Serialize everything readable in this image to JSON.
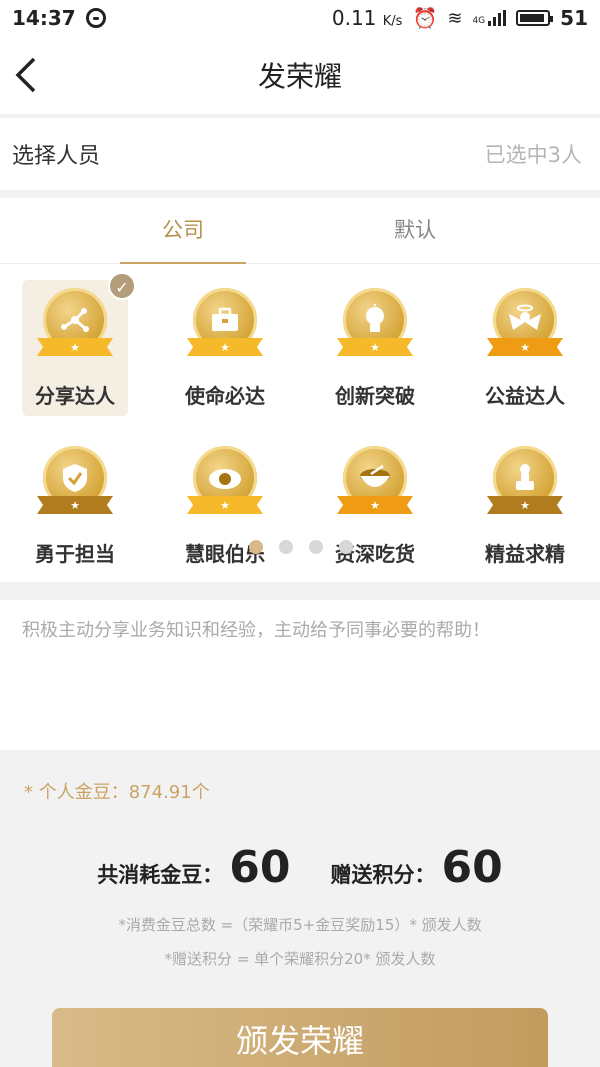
{
  "status_bar": {
    "time": "14:37",
    "speed": "0.11",
    "speed_unit": "K/s",
    "network": "4G",
    "battery": "51"
  },
  "nav": {
    "title": "发荣耀"
  },
  "select_people": {
    "label": "选择人员",
    "value": "已选中3人"
  },
  "tabs": [
    {
      "label": "公司"
    },
    {
      "label": "默认"
    }
  ],
  "badges": [
    {
      "label": "分享达人",
      "icon": "share-nodes"
    },
    {
      "label": "使命必达",
      "icon": "briefcase"
    },
    {
      "label": "创新突破",
      "icon": "lightbulb"
    },
    {
      "label": "公益达人",
      "icon": "angel"
    },
    {
      "label": "勇于担当",
      "icon": "shield"
    },
    {
      "label": "慧眼伯乐",
      "icon": "eye"
    },
    {
      "label": "资深吃货",
      "icon": "bowl"
    },
    {
      "label": "精益求精",
      "icon": "tools"
    }
  ],
  "selected_badge_index": 0,
  "pager": {
    "count": 4,
    "active": 0
  },
  "description": "积极主动分享业务知识和经验，主动给予同事必要的帮助！",
  "summary": {
    "beans": "* 个人金豆：874.91个",
    "consume_label": "共消耗金豆：",
    "consume_value": "60",
    "points_label": "赠送积分：",
    "points_value": "60",
    "note1": "*消费金豆总数 =（荣耀币5+金豆奖励15）* 颁发人数",
    "note2": "*赠送积分 = 单个荣耀积分20* 颁发人数"
  },
  "button": {
    "label": "颁发荣耀"
  },
  "colors": {
    "accent": "#c9a466",
    "button_start": "#d8bb89",
    "button_end": "#c29b5e"
  }
}
